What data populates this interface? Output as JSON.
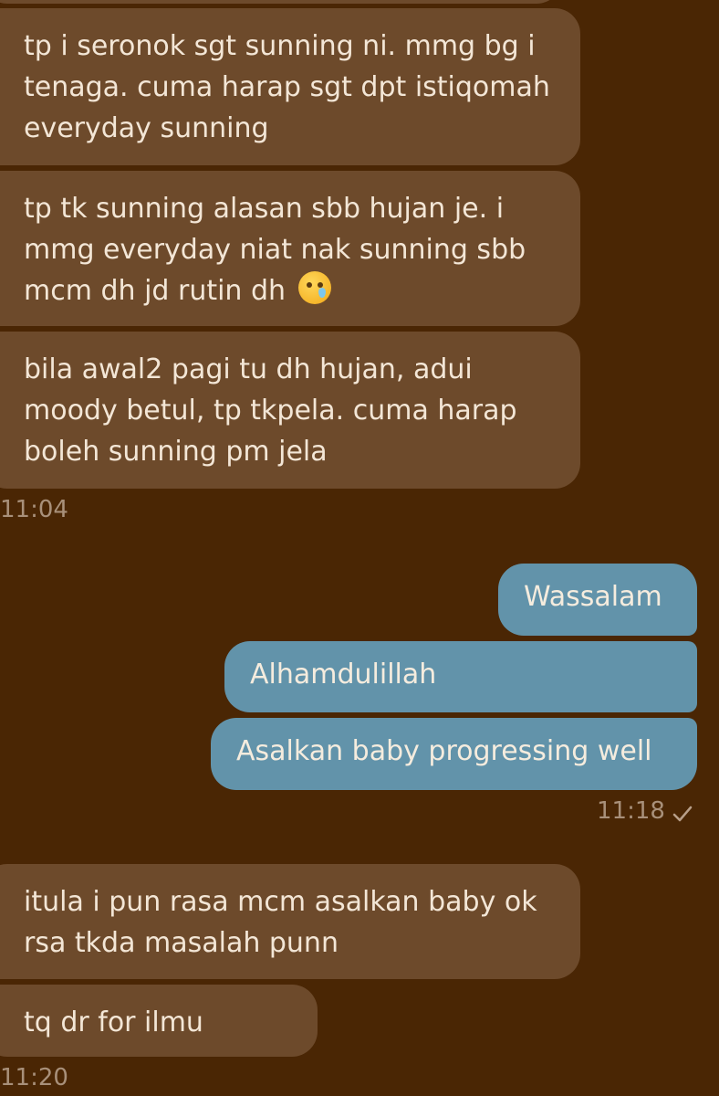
{
  "conversation": {
    "incoming_group_1": [
      "tp i seronok sgt sunning ni. mmg bg i tenaga. cuma harap sgt dpt istiqomah everyday sunning",
      "tp tk sunning alasan sbb hujan je. i mmg everyday niat nak sunning sbb mcm dh jd rutin dh",
      "bila awal2 pagi tu dh hujan, adui moody betul, tp tkpela. cuma harap boleh sunning pm jela"
    ],
    "incoming_group_1_time": "11:04",
    "outgoing_group": [
      "Wassalam",
      "Alhamdulillah",
      "Asalkan baby progressing well"
    ],
    "outgoing_group_time": "11:18",
    "incoming_group_2": [
      "itula i pun rasa mcm asalkan baby ok rsa tkda masalah punn",
      "tq dr for ilmu"
    ],
    "incoming_group_2_time": "11:20",
    "emoji_icon": "face-holding-back-tears-icon",
    "read_status_icon": "check-icon"
  },
  "colors": {
    "background": "#4a2604",
    "incoming_bubble": "#6d4a2b",
    "outgoing_bubble": "#6293aa",
    "text": "#f3e6d6",
    "timestamp": "#a8907a"
  }
}
